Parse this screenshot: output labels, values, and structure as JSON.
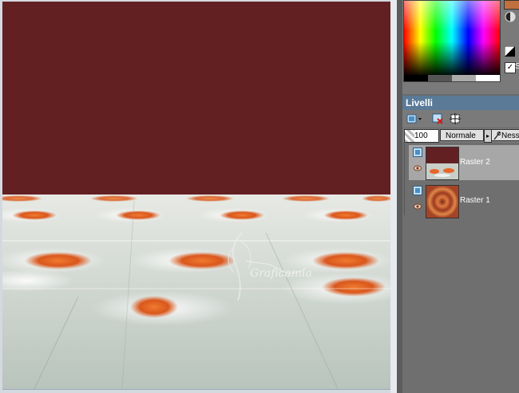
{
  "palette": {
    "checkbox_label": "S",
    "checkbox_mark": "✓"
  },
  "layers": {
    "title": "Livelli",
    "opacity": "100",
    "blend_mode": "Normale",
    "blend_arrow": "▸",
    "lock_mode": "Nessu",
    "items": [
      {
        "label": "Raster 2",
        "selected": true
      },
      {
        "label": "Raster 1",
        "selected": false
      }
    ]
  },
  "canvas": {
    "watermark": "Graficamia",
    "colors": {
      "background": "#632023",
      "floor": "#c9cfc8",
      "accent": "#e8662a"
    }
  },
  "icons": [
    "new-layer-icon",
    "delete-layer-icon",
    "mask-icon",
    "eye-icon",
    "lock-icon",
    "layer-type-icon"
  ]
}
